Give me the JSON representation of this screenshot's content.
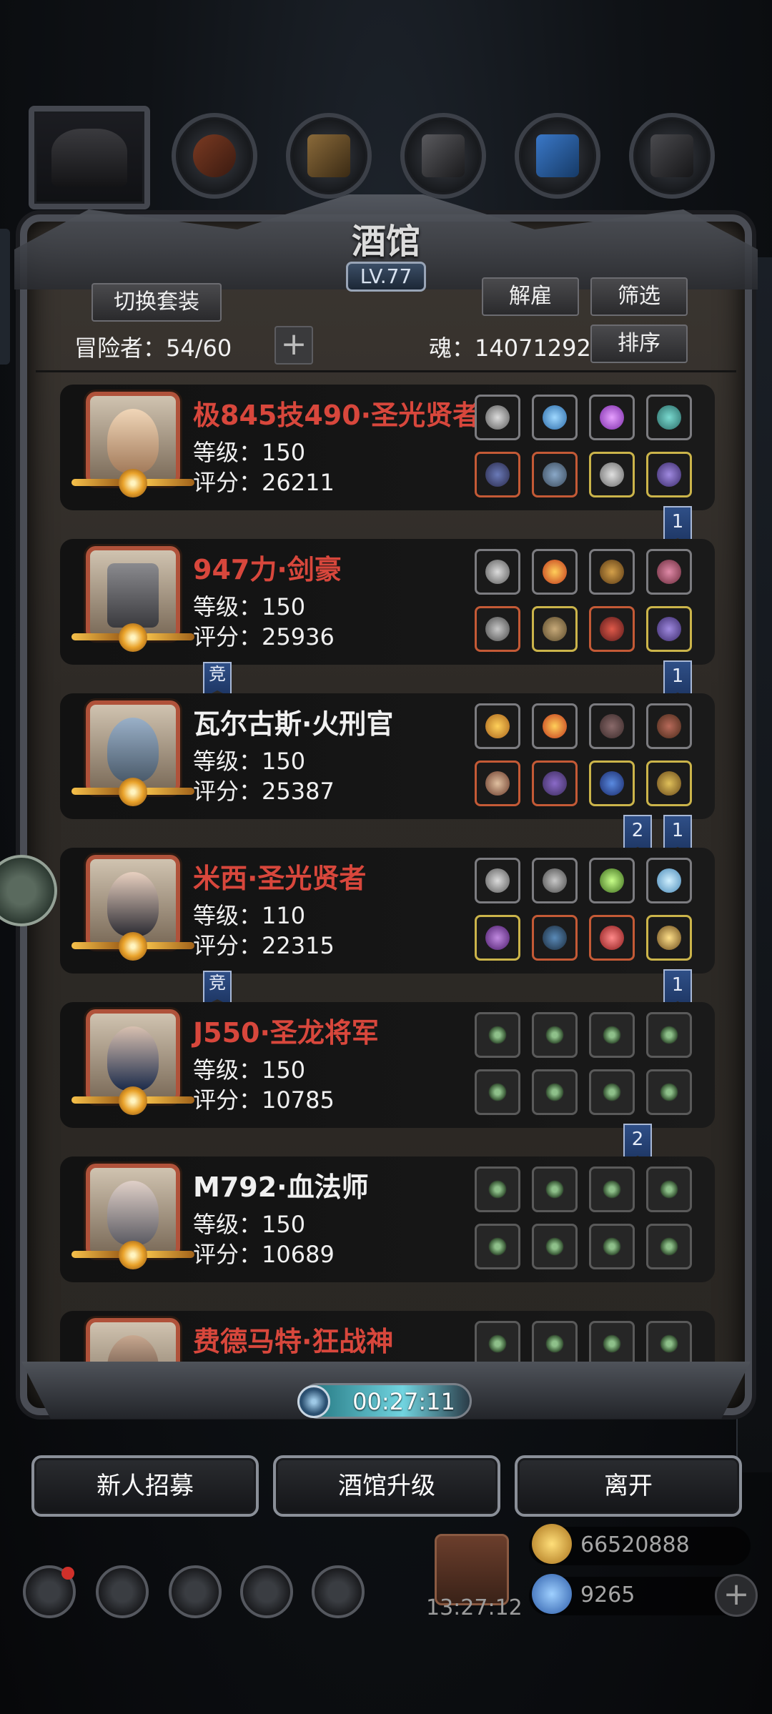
{
  "title": "酒馆",
  "level": "LV.77",
  "buttons": {
    "switch_set": "切换套装",
    "hire": "解雇",
    "filter": "筛选",
    "sort": "排序",
    "plus": "+"
  },
  "adventurers_label": "冒险者：54/60",
  "soul_label": "魂：14071292",
  "heroes": [
    {
      "name": "极845技490·圣光贤者",
      "level": "等级：150",
      "score": "评分：26211",
      "name_color": "red"
    },
    {
      "name": "947力·剑豪",
      "level": "等级：150",
      "score": "评分：25936",
      "name_color": "red"
    },
    {
      "name": "瓦尔古斯·火刑官",
      "level": "等级：150",
      "score": "评分：25387",
      "name_color": "white"
    },
    {
      "name": "米西·圣光贤者",
      "level": "等级：110",
      "score": "评分：22315",
      "name_color": "red"
    },
    {
      "name": "J550·圣龙将军",
      "level": "等级：150",
      "score": "评分：10785",
      "name_color": "red"
    },
    {
      "name": "M792·血法师",
      "level": "等级：150",
      "score": "评分：10689",
      "name_color": "white"
    },
    {
      "name": "费德马特·狂战神",
      "level": "",
      "score": "",
      "name_color": "red"
    }
  ],
  "ribbons": {
    "r1": "1",
    "r2": "1",
    "r3a": "2",
    "r3b": "1",
    "r4": "1",
    "r5": "2",
    "jing": "竞"
  },
  "timer": "00:27:11",
  "bottom_buttons": {
    "recruit": "新人招募",
    "upgrade": "酒馆升级",
    "leave": "离开"
  },
  "hud": {
    "clock": "13:27:12",
    "gold": "66520888",
    "gems": "9265",
    "add": "+"
  },
  "colors": {
    "name_red": "#d8473c",
    "ribbon_blue": "#2f4f87",
    "timer_cyan": "#71d4e0"
  }
}
